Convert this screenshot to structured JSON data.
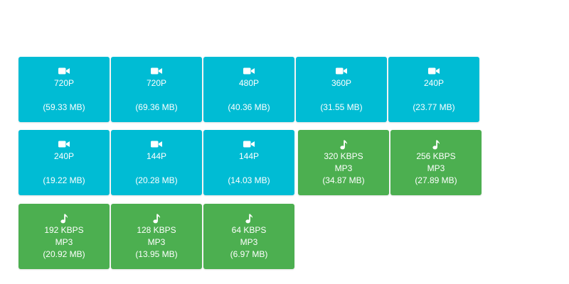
{
  "colors": {
    "video": "#00bcd4",
    "audio": "#4caf50"
  },
  "downloads": [
    {
      "kind": "video",
      "icon": "video-camera-icon",
      "quality": "720P",
      "size": "(59.33 MB)"
    },
    {
      "kind": "video",
      "icon": "video-camera-icon",
      "quality": "720P",
      "size": "(69.36 MB)"
    },
    {
      "kind": "video",
      "icon": "video-camera-icon",
      "quality": "480P",
      "size": "(40.36 MB)"
    },
    {
      "kind": "video",
      "icon": "video-camera-icon",
      "quality": "360P",
      "size": "(31.55 MB)"
    },
    {
      "kind": "video",
      "icon": "video-camera-icon",
      "quality": "240P",
      "size": "(23.77 MB)"
    },
    {
      "kind": "video",
      "icon": "video-camera-icon",
      "quality": "240P",
      "size": "(19.22 MB)"
    },
    {
      "kind": "video",
      "icon": "video-camera-icon",
      "quality": "144P",
      "size": "(20.28 MB)"
    },
    {
      "kind": "video",
      "icon": "video-camera-icon",
      "quality": "144P",
      "size": "(14.03 MB)"
    },
    {
      "kind": "audio",
      "icon": "music-note-icon",
      "quality": "320 KBPS",
      "format": "MP3",
      "size": "(34.87 MB)"
    },
    {
      "kind": "audio",
      "icon": "music-note-icon",
      "quality": "256 KBPS",
      "format": "MP3",
      "size": "(27.89 MB)"
    },
    {
      "kind": "audio",
      "icon": "music-note-icon",
      "quality": "192 KBPS",
      "format": "MP3",
      "size": "(20.92 MB)"
    },
    {
      "kind": "audio",
      "icon": "music-note-icon",
      "quality": "128 KBPS",
      "format": "MP3",
      "size": "(13.95 MB)"
    },
    {
      "kind": "audio",
      "icon": "music-note-icon",
      "quality": "64 KBPS",
      "format": "MP3",
      "size": "(6.97 MB)"
    }
  ]
}
